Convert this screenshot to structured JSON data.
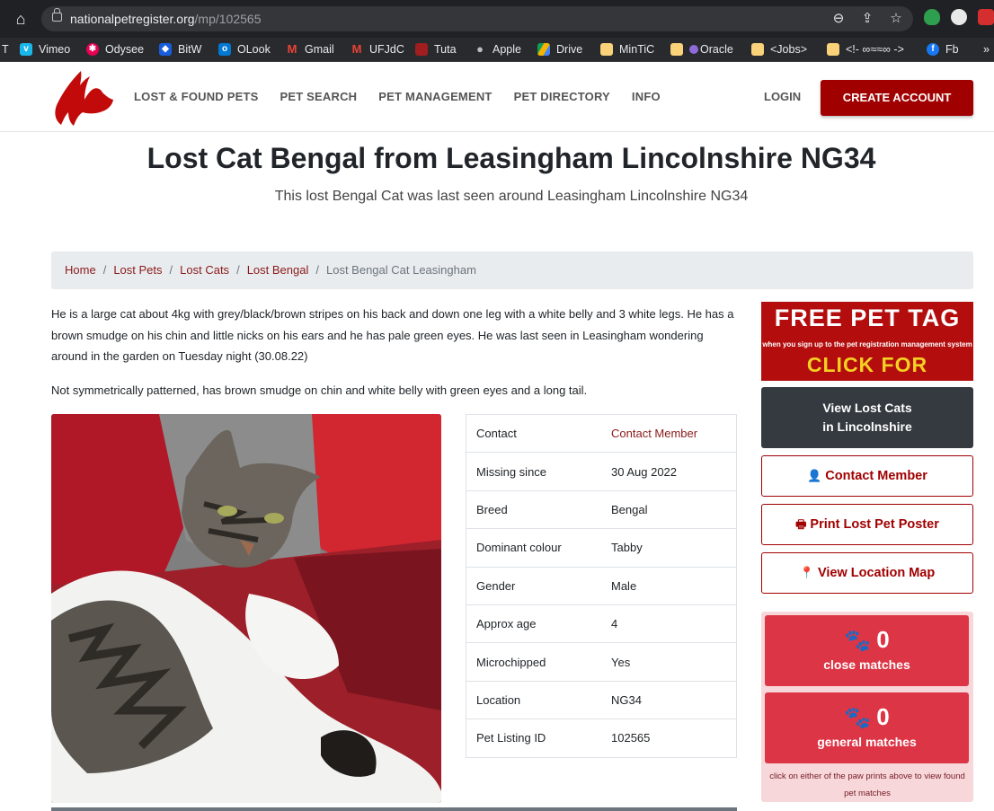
{
  "browser": {
    "url_host": "nationalpetregister.org",
    "url_path": "/mp/102565",
    "bookmarks": [
      "T",
      "Vimeo",
      "Odysee",
      "BitW",
      "OLook",
      "Gmail",
      "UFJdC",
      "Tuta",
      "Apple",
      "Drive",
      "MinTiC",
      "Oracle",
      "<Jobs>",
      "<!- ∞≈≈∞ ->",
      "Fb",
      "»"
    ]
  },
  "header": {
    "nav": [
      "LOST & FOUND PETS",
      "PET SEARCH",
      "PET MANAGEMENT",
      "PET DIRECTORY",
      "INFO"
    ],
    "login": "LOGIN",
    "create_account": "CREATE ACCOUNT",
    "brand_color": "#a10000"
  },
  "page": {
    "title": "Lost Cat Bengal from Leasingham Lincolnshire NG34",
    "subtitle": "This lost Bengal Cat was last seen around Leasingham Lincolnshire NG34"
  },
  "breadcrumb": {
    "links": [
      "Home",
      "Lost Pets",
      "Lost Cats",
      "Lost Bengal"
    ],
    "current": "Lost Bengal Cat Leasingham"
  },
  "description": {
    "p1": "He is a large cat about 4kg with grey/black/brown stripes on his back and down one leg with a white belly and 3 white legs. He has a brown smudge on his chin and little nicks on his ears and he has pale green eyes. He was last seen in Leasingham wondering around in the garden on Tuesday night (30.08.22)",
    "p2": "Not symmetrically patterned, has brown smudge on chin and white belly with green eyes and a long tail."
  },
  "details": {
    "contact_label": "Contact",
    "contact_value": "Contact Member",
    "missing_label": "Missing since",
    "missing_value": "30 Aug 2022",
    "breed_label": "Breed",
    "breed_value": "Bengal",
    "colour_label": "Dominant colour",
    "colour_value": "Tabby",
    "gender_label": "Gender",
    "gender_value": "Male",
    "age_label": "Approx age",
    "age_value": "4",
    "chip_label": "Microchipped",
    "chip_value": "Yes",
    "location_label": "Location",
    "location_value": "NG34",
    "id_label": "Pet Listing ID",
    "id_value": "102565"
  },
  "sidebar": {
    "promo_line1": "FREE PET TAG",
    "promo_line2": "when you sign up to the pet registration management system",
    "promo_line3": "CLICK FOR DETAILS",
    "view_lost_line1": "View Lost Cats",
    "view_lost_line2": "in Lincolnshire",
    "contact_btn": "Contact Member",
    "print_btn": "Print Lost Pet Poster",
    "map_btn": "View Location Map",
    "close_count": "0",
    "close_label": "close matches",
    "general_count": "0",
    "general_label": "general matches",
    "hint": "click on either of the paw prints above to view found pet matches"
  }
}
